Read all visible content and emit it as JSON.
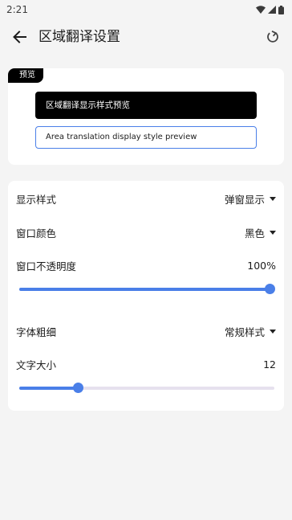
{
  "status_bar": {
    "time": "2:21"
  },
  "header": {
    "title": "区域翻译设置",
    "back_icon": "arrow-left-icon",
    "reset_icon": "refresh-icon"
  },
  "preview": {
    "tag": "预览",
    "dark_text": "区域翻译显示样式预览",
    "light_text": "Area translation display style preview"
  },
  "settings": {
    "display_style": {
      "label": "显示样式",
      "value": "弹窗显示"
    },
    "window_color": {
      "label": "窗口颜色",
      "value": "黑色"
    },
    "window_opacity": {
      "label": "窗口不透明度",
      "value": "100%",
      "level": 1.0
    },
    "font_weight": {
      "label": "字体粗细",
      "value": "常规样式"
    },
    "font_size": {
      "label": "文字大小",
      "value": "12",
      "level": 0.235
    }
  },
  "colors": {
    "accent": "#4a7fe8",
    "track": "#e6e1ee",
    "background": "#f4f4f4"
  }
}
